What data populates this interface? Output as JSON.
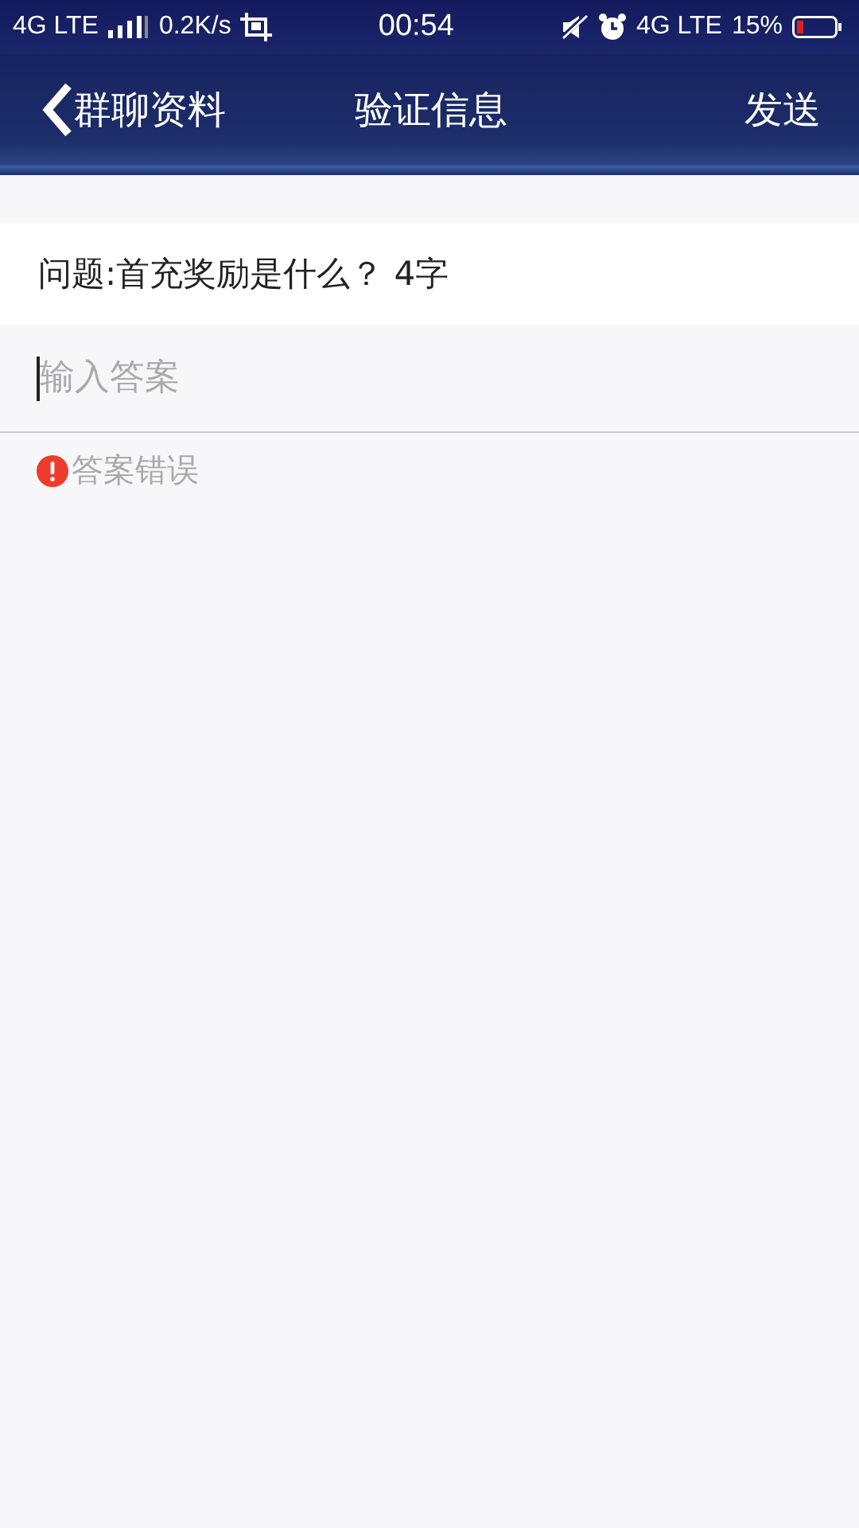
{
  "status_bar": {
    "network": "4G LTE",
    "speed": "0.2K/s",
    "time": "00:54",
    "network_right": "4G LTE",
    "battery": "15%"
  },
  "nav": {
    "back_label": "群聊资料",
    "title": "验证信息",
    "action": "发送"
  },
  "question": "问题:首充奖励是什么？ 4字",
  "answer_field": {
    "placeholder": "输入答案"
  },
  "error": {
    "text": "答案错误"
  }
}
